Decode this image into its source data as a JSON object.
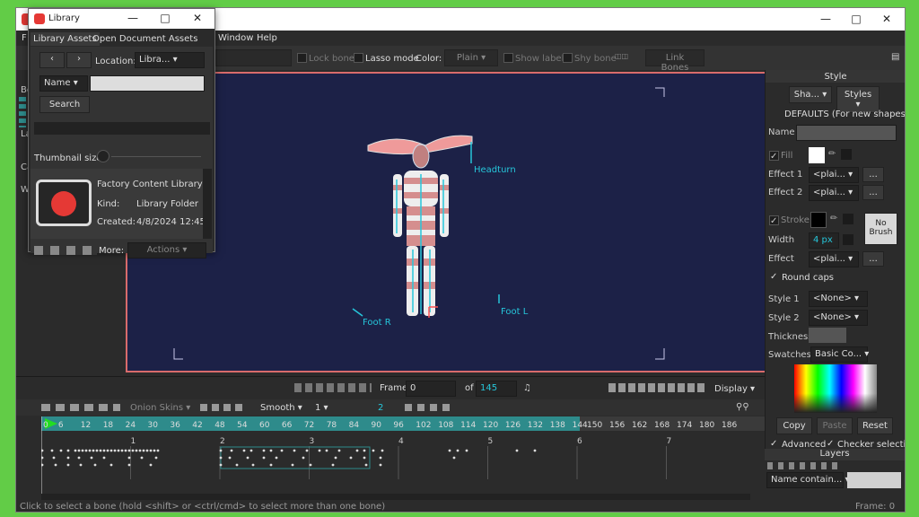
{
  "menu": {
    "file": "F",
    "window": "Window",
    "help": "Help"
  },
  "toolbar": {
    "field_value": "",
    "lock_bone": "Lock bone",
    "lasso_mode": "Lasso mode",
    "color_label": "Color:",
    "color_value": "Plain",
    "show_label": "Show label",
    "shy_bone": "Shy bone",
    "link_bones": "Link Bones"
  },
  "left_tabs": [
    "Bo",
    "La",
    "Ca",
    "W"
  ],
  "canvas": {
    "labels": [
      "Headturn",
      "Foot R",
      "Foot L"
    ]
  },
  "library": {
    "title": "Library",
    "tabs": [
      "Library Assets",
      "Open Document Assets"
    ],
    "location_label": "Location:",
    "location_value": "Libra...",
    "name_dropdown": "Name",
    "search_placeholder": "",
    "search_button": "Search",
    "thumbnail_label": "Thumbnail size:",
    "item_name": "Factory Content Library",
    "kind_label": "Kind:",
    "kind_value": "Library Folder",
    "created_label": "Created:",
    "created_value": "4/8/2024 12:45",
    "more_label": "More:",
    "actions": "Actions"
  },
  "style": {
    "header": "Style",
    "shapes_btn": "Sha...",
    "styles_btn": "Styles",
    "defaults": "DEFAULTS (For new shapes)",
    "name_label": "Name",
    "name_value": "",
    "fill_label": "Fill",
    "effect1_label": "Effect 1",
    "effect1_value": "<plai...",
    "effect2_label": "Effect 2",
    "effect2_value": "<plai...",
    "stroke_label": "Stroke",
    "width_label": "Width",
    "width_value": "4 px",
    "no_brush": "No Brush",
    "effect_label": "Effect",
    "effect_value": "<plai...",
    "round_caps": "Round caps",
    "style1_label": "Style 1",
    "style1_value": "<None>",
    "style2_label": "Style 2",
    "style2_value": "<None>",
    "thickness_label": "Thickness",
    "swatches_label": "Swatches",
    "swatches_value": "Basic Co...",
    "copy": "Copy",
    "paste": "Paste",
    "reset": "Reset",
    "advanced": "Advanced",
    "checker": "Checker selection",
    "layers": "Layers",
    "layer_filter": "Name contain...",
    "dots": "...",
    "colors": {
      "accent": "#2e8b8b",
      "canvas_bg": "#1c2147",
      "canvas_border": "#d86b6b"
    }
  },
  "playback": {
    "frame_label": "Frame",
    "frame_value": "0",
    "of_label": "of",
    "total": "145",
    "display": "Display"
  },
  "timeline": {
    "onion_skins": "Onion Skins",
    "interp": "Smooth",
    "one": "1",
    "two": "2",
    "ruler_a": [
      "0",
      "6",
      "12",
      "18",
      "24",
      "30",
      "36",
      "42",
      "48",
      "54",
      "60",
      "66",
      "72",
      "78",
      "84",
      "90",
      "96",
      "102",
      "108",
      "114",
      "120",
      "126",
      "132",
      "138",
      "144"
    ],
    "ruler_b": [
      "150",
      "156",
      "162",
      "168",
      "174",
      "180",
      "186"
    ],
    "seconds": [
      "1",
      "2",
      "3",
      "4",
      "5",
      "6",
      "7"
    ]
  },
  "status": {
    "hint": "Click to select a bone (hold <shift> or <ctrl/cmd> to select more than one bone)",
    "frame": "Frame: 0"
  }
}
